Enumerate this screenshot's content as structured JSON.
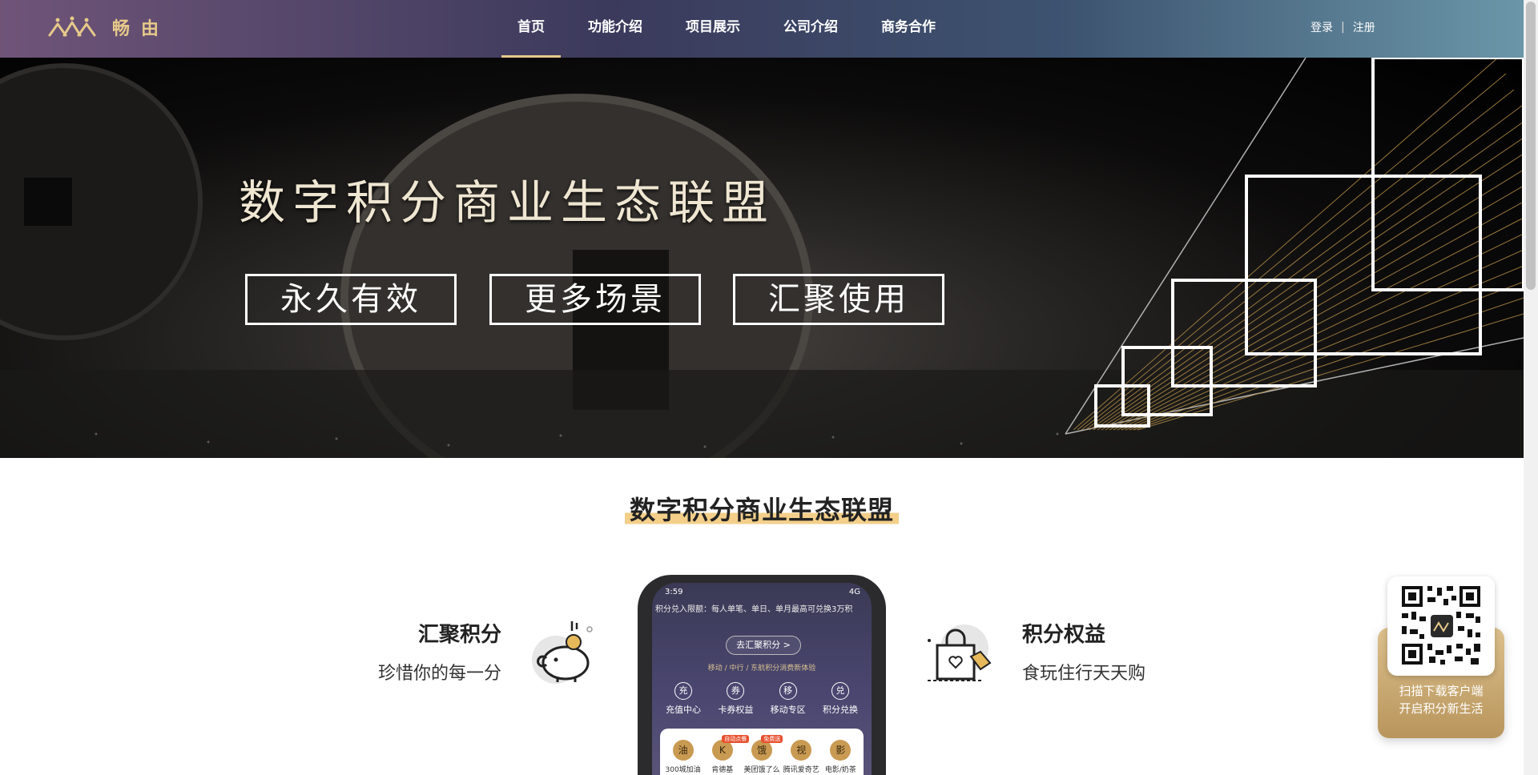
{
  "header": {
    "logo_text": "畅由",
    "brand_color": "#e7c98a",
    "nav": [
      {
        "label": "首页",
        "active": true
      },
      {
        "label": "功能介绍",
        "active": false
      },
      {
        "label": "项目展示",
        "active": false
      },
      {
        "label": "公司介绍",
        "active": false
      },
      {
        "label": "商务合作",
        "active": false
      }
    ],
    "login": "登录",
    "separator": "|",
    "register": "注册"
  },
  "banner": {
    "title": "数字积分商业生态联盟",
    "tags": [
      "永久有效",
      "更多场景",
      "汇聚使用"
    ]
  },
  "section": {
    "title": "数字积分商业生态联盟",
    "highlight_color": "#f3cf8a",
    "left_feature": {
      "title": "汇聚积分",
      "subtitle": "珍惜你的每一分",
      "icon": "piggy-bank-icon"
    },
    "right_feature": {
      "title": "积分权益",
      "subtitle": "食玩住行天天购",
      "icon": "shopping-bag-icon"
    }
  },
  "phone": {
    "time": "3:59",
    "network": "4G",
    "ticker": "积分兑入限额：每人单笔、单日、单月最高可兑换3万积",
    "collect_button": "去汇聚积分 >",
    "partners": "移动 / 中行 / 东航积分消费新体验",
    "services": [
      {
        "label": "充值中心",
        "icon": "充"
      },
      {
        "label": "卡券权益",
        "icon": "券"
      },
      {
        "label": "移动专区",
        "icon": "移"
      },
      {
        "label": "积分兑换",
        "icon": "兑"
      }
    ],
    "cards": [
      {
        "label": "300城加油",
        "icon": "油",
        "badge": ""
      },
      {
        "label": "肯德基",
        "icon": "K",
        "badge": "自动点餐"
      },
      {
        "label": "美团饿了么",
        "icon": "饿",
        "badge": "免费送"
      },
      {
        "label": "腾讯爱奇艺",
        "icon": "视",
        "badge": ""
      },
      {
        "label": "电影/奶茶",
        "icon": "影",
        "badge": ""
      }
    ]
  },
  "qr_widget": {
    "line1": "扫描下载客户端",
    "line2": "开启积分新生活"
  }
}
